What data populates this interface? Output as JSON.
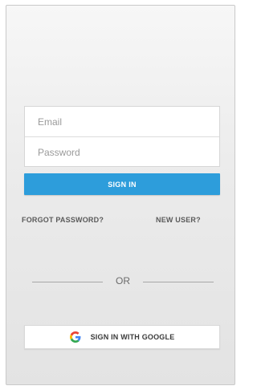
{
  "login_form": {
    "email_placeholder": "Email",
    "password_placeholder": "Password",
    "email_value": "",
    "password_value": ""
  },
  "actions": {
    "sign_in_label": "SIGN IN",
    "forgot_password_label": "FORGOT PASSWORD?",
    "new_user_label": "NEW USER?"
  },
  "separator": {
    "label": "OR"
  },
  "google": {
    "label": "SIGN IN WITH GOOGLE",
    "icon": "google-g-icon"
  },
  "colors": {
    "accent": "#2d9ddb",
    "google_blue": "#4285f4",
    "google_red": "#ea4335",
    "google_yellow": "#fbbc05",
    "google_green": "#34a853"
  }
}
